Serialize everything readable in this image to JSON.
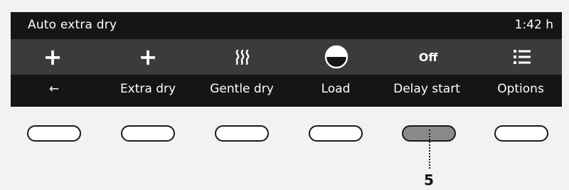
{
  "display": {
    "mode_title": "Auto extra dry",
    "time_remaining": "1:42 h"
  },
  "icons": [
    {
      "name": "plus-icon",
      "text": "+"
    },
    {
      "name": "plus-icon",
      "text": "+"
    },
    {
      "name": "gentle-heat-icon"
    },
    {
      "name": "load-half-circle-icon"
    },
    {
      "name": "delay-off-indicator",
      "text": "Off"
    },
    {
      "name": "options-list-icon"
    }
  ],
  "soft_keys": [
    {
      "label": "←"
    },
    {
      "label": "Extra dry"
    },
    {
      "label": "Gentle dry"
    },
    {
      "label": "Load"
    },
    {
      "label": "Delay start"
    },
    {
      "label": "Options"
    }
  ],
  "highlighted_button": 5,
  "callout": "5"
}
